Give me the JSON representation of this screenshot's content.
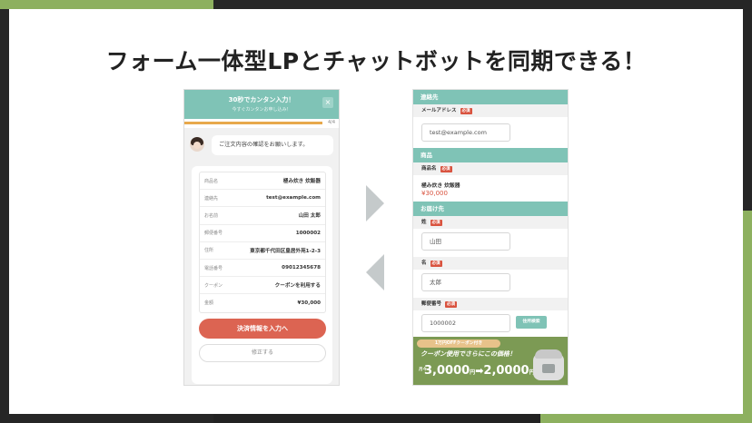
{
  "headline": "フォーム一体型LPとチャットボットを同期できる！",
  "chat": {
    "title": "30秒でカンタン入力！",
    "subtitle": "今すぐカンタンお申し込み！",
    "close": "×",
    "progress_label": "4/4",
    "progress_fraction": 1.0,
    "bot_message": "ご注文内容の確認をお願いします。",
    "summary": [
      {
        "key": "商品名",
        "value": "極み炊き 炊飯器"
      },
      {
        "key": "連絡先",
        "value": "test@example.com"
      },
      {
        "key": "お名前",
        "value": "山田 太郎"
      },
      {
        "key": "郵便番号",
        "value": "1000002"
      },
      {
        "key": "住所",
        "value": "東京都千代田区皇居外苑1-2-3"
      },
      {
        "key": "電話番号",
        "value": "09012345678"
      },
      {
        "key": "クーポン",
        "value": "クーポンを利用する"
      },
      {
        "key": "金額",
        "value": "¥30,000"
      }
    ],
    "cta_label": "決済情報を入力へ",
    "edit_label": "修正する"
  },
  "form": {
    "contact_header": "連絡先",
    "email_label": "メールアドレス",
    "required_tag": "必須",
    "email_value": "test@example.com",
    "product_header": "商品",
    "product_label": "商品名",
    "product_name": "極み炊き 炊飯器",
    "product_price": "¥30,000",
    "delivery_header": "お届け先",
    "last_name_label": "姓",
    "last_name_value": "山田",
    "first_name_label": "名",
    "first_name_value": "太郎",
    "zip_label": "郵便番号",
    "zip_value": "1000002",
    "address_search_label": "住所検索"
  },
  "banner": {
    "pill": "1万円OFFクーポン付き",
    "line1": "クーポン使用でさらにこの価格！",
    "prefix": "月々",
    "old_price": "3,0000",
    "old_unit": "円",
    "arrow": "➡",
    "new_price": "2,0000",
    "new_unit": "円"
  }
}
